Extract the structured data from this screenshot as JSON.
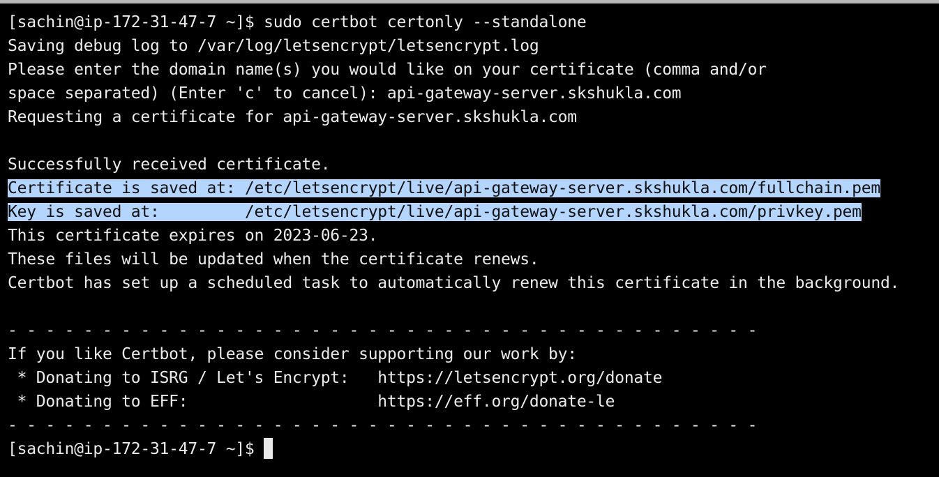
{
  "terminal": {
    "lines": [
      "[sachin@ip-172-31-47-7 ~]$ sudo certbot certonly --standalone",
      "Saving debug log to /var/log/letsencrypt/letsencrypt.log",
      "Please enter the domain name(s) you would like on your certificate (comma and/or",
      "space separated) (Enter 'c' to cancel): api-gateway-server.skshukla.com",
      "Requesting a certificate for api-gateway-server.skshukla.com",
      "",
      "Successfully received certificate.",
      "Certificate is saved at: /etc/letsencrypt/live/api-gateway-server.skshukla.com/fullchain.pem",
      "Key is saved at:         /etc/letsencrypt/live/api-gateway-server.skshukla.com/privkey.pem",
      "This certificate expires on 2023-06-23.",
      "These files will be updated when the certificate renews.",
      "Certbot has set up a scheduled task to automatically renew this certificate in the background.",
      "",
      "- - - - - - - - - - - - - - - - - - - - - - - - - - - - - - - - - - - - - - - -",
      "If you like Certbot, please consider supporting our work by:",
      " * Donating to ISRG / Let's Encrypt:   https://letsencrypt.org/donate",
      " * Donating to EFF:                    https://eff.org/donate-le",
      "- - - - - - - - - - - - - - - - - - - - - - - - - - - - - - - - - - - - - - - -"
    ],
    "prompt": "[sachin@ip-172-31-47-7 ~]$ "
  },
  "colors": {
    "background": "#000000",
    "foreground": "#ebebeb",
    "selection": "#b4d5fe",
    "window_border": "#b8b8b8"
  }
}
